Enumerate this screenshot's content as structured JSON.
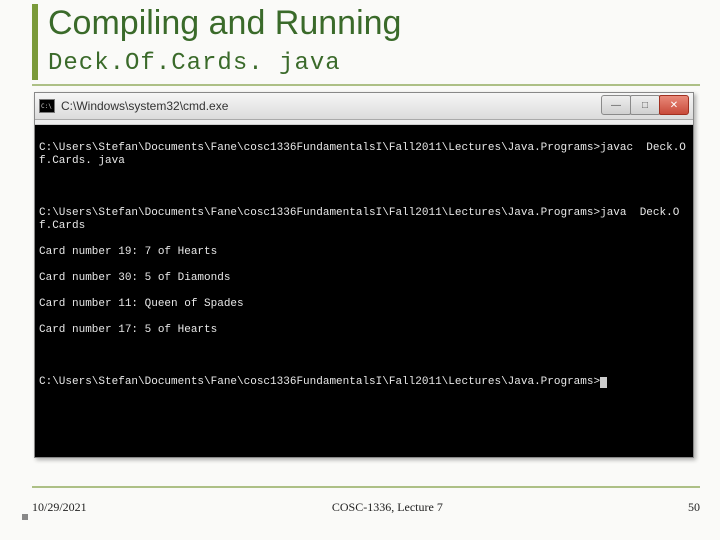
{
  "slide": {
    "title": "Compiling and Running",
    "subtitle": "Deck.Of.Cards. java"
  },
  "window": {
    "title": "C:\\Windows\\system32\\cmd.exe",
    "icon_label": "C:\\"
  },
  "terminal": {
    "lines": [
      "C:\\Users\\Stefan\\Documents\\Fane\\cosc1336FundamentalsI\\Fall2011\\Lectures\\Java.Programs>javac  Deck.Of.Cards. java",
      "",
      "C:\\Users\\Stefan\\Documents\\Fane\\cosc1336FundamentalsI\\Fall2011\\Lectures\\Java.Programs>java  Deck.Of.Cards",
      "Card number 19: 7 of Hearts",
      "Card number 30: 5 of Diamonds",
      "Card number 11: Queen of Spades",
      "Card number 17: 5 of Hearts",
      "",
      "C:\\Users\\Stefan\\Documents\\Fane\\cosc1336FundamentalsI\\Fall2011\\Lectures\\Java.Programs>"
    ]
  },
  "footer": {
    "date": "10/29/2021",
    "center": "COSC-1336, Lecture 7",
    "page": "50"
  },
  "buttons": {
    "min": "—",
    "max": "□",
    "close": "✕"
  }
}
